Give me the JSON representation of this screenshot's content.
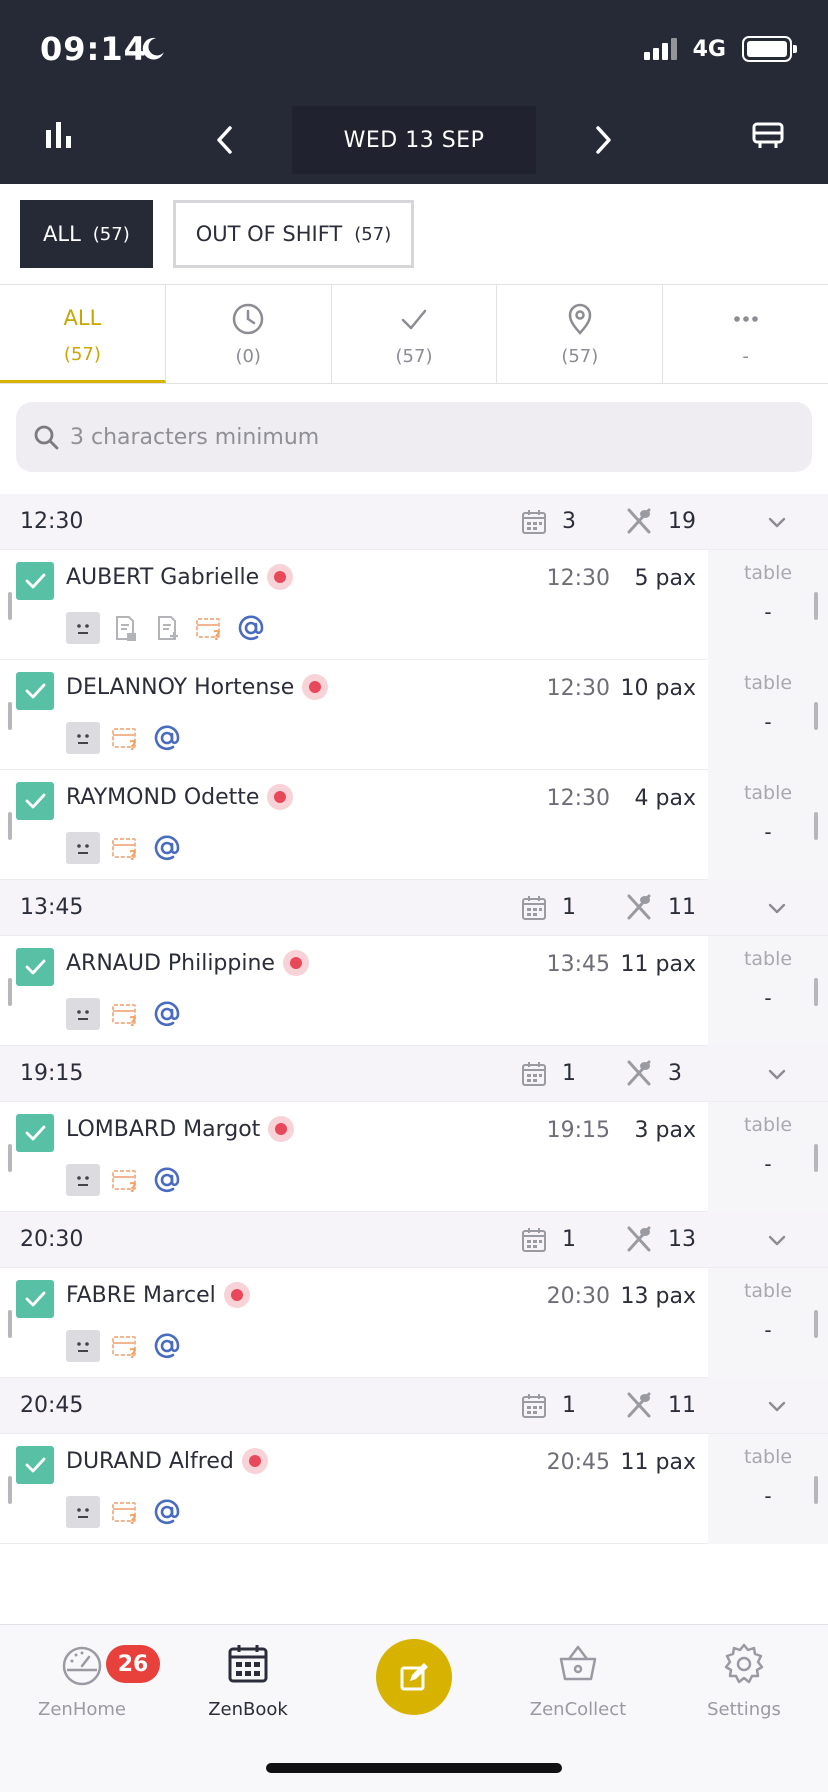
{
  "status_bar": {
    "time": "09:14",
    "network": "4G"
  },
  "header": {
    "date": "WED 13 SEP"
  },
  "shift_filters": [
    {
      "label": "ALL",
      "count": "(57)",
      "active": true
    },
    {
      "label": "OUT OF SHIFT",
      "count": "(57)",
      "active": false
    }
  ],
  "status_tabs": [
    {
      "label": "ALL",
      "count": "(57)",
      "icon": "",
      "active": true
    },
    {
      "label": "",
      "count": "(0)",
      "icon": "clock-icon",
      "active": false
    },
    {
      "label": "",
      "count": "(57)",
      "icon": "check-icon",
      "active": false
    },
    {
      "label": "",
      "count": "(57)",
      "icon": "location-pin-icon",
      "active": false
    },
    {
      "label": "",
      "count": "-",
      "icon": "more-dots-icon",
      "active": false
    }
  ],
  "search": {
    "placeholder": "3 characters minimum"
  },
  "groups": [
    {
      "time": "12:30",
      "reservations": "3",
      "covers": "19",
      "rows": [
        {
          "name": "AUBERT Gabrielle",
          "time": "12:30",
          "pax": "5 pax",
          "table_label": "table",
          "table": "-",
          "icons": [
            "neutral-face-icon",
            "document-lock-icon",
            "document-plus-icon",
            "card-question-icon",
            "at-sign-icon"
          ]
        },
        {
          "name": "DELANNOY Hortense",
          "time": "12:30",
          "pax": "10 pax",
          "table_label": "table",
          "table": "-",
          "icons": [
            "neutral-face-icon",
            "card-question-icon",
            "at-sign-icon"
          ]
        },
        {
          "name": "RAYMOND Odette",
          "time": "12:30",
          "pax": "4 pax",
          "table_label": "table",
          "table": "-",
          "icons": [
            "neutral-face-icon",
            "card-question-icon",
            "at-sign-icon"
          ]
        }
      ]
    },
    {
      "time": "13:45",
      "reservations": "1",
      "covers": "11",
      "rows": [
        {
          "name": "ARNAUD Philippine",
          "time": "13:45",
          "pax": "11 pax",
          "table_label": "table",
          "table": "-",
          "icons": [
            "neutral-face-icon",
            "card-question-icon",
            "at-sign-icon"
          ]
        }
      ]
    },
    {
      "time": "19:15",
      "reservations": "1",
      "covers": "3",
      "rows": [
        {
          "name": "LOMBARD Margot",
          "time": "19:15",
          "pax": "3 pax",
          "table_label": "table",
          "table": "-",
          "icons": [
            "neutral-face-icon",
            "card-question-icon",
            "at-sign-icon"
          ]
        }
      ]
    },
    {
      "time": "20:30",
      "reservations": "1",
      "covers": "13",
      "rows": [
        {
          "name": "FABRE Marcel",
          "time": "20:30",
          "pax": "13 pax",
          "table_label": "table",
          "table": "-",
          "icons": [
            "neutral-face-icon",
            "card-question-icon",
            "at-sign-icon"
          ]
        }
      ]
    },
    {
      "time": "20:45",
      "reservations": "1",
      "covers": "11",
      "rows": [
        {
          "name": "DURAND Alfred",
          "time": "20:45",
          "pax": "11 pax",
          "table_label": "table",
          "table": "-",
          "icons": [
            "neutral-face-icon",
            "card-question-icon",
            "at-sign-icon"
          ]
        }
      ]
    }
  ],
  "bottom_nav": [
    {
      "label": "ZenHome",
      "icon": "dashboard-gauge-icon",
      "badge": "26",
      "active": false
    },
    {
      "label": "ZenBook",
      "icon": "calendar-icon",
      "badge": "",
      "active": true
    },
    {
      "label": "",
      "icon": "edit-icon",
      "badge": "",
      "active": false
    },
    {
      "label": "ZenCollect",
      "icon": "basket-icon",
      "badge": "",
      "active": false
    },
    {
      "label": "Settings",
      "icon": "gear-icon",
      "badge": "",
      "active": false
    }
  ],
  "colors": {
    "header_bg": "#262a37",
    "accent_yellow": "#d7b300",
    "check_green": "#58c0a4",
    "alert_red": "#e8485a",
    "badge_red": "#e8413c",
    "email_blue": "#4a6cc0",
    "card_orange": "#f2b590"
  }
}
